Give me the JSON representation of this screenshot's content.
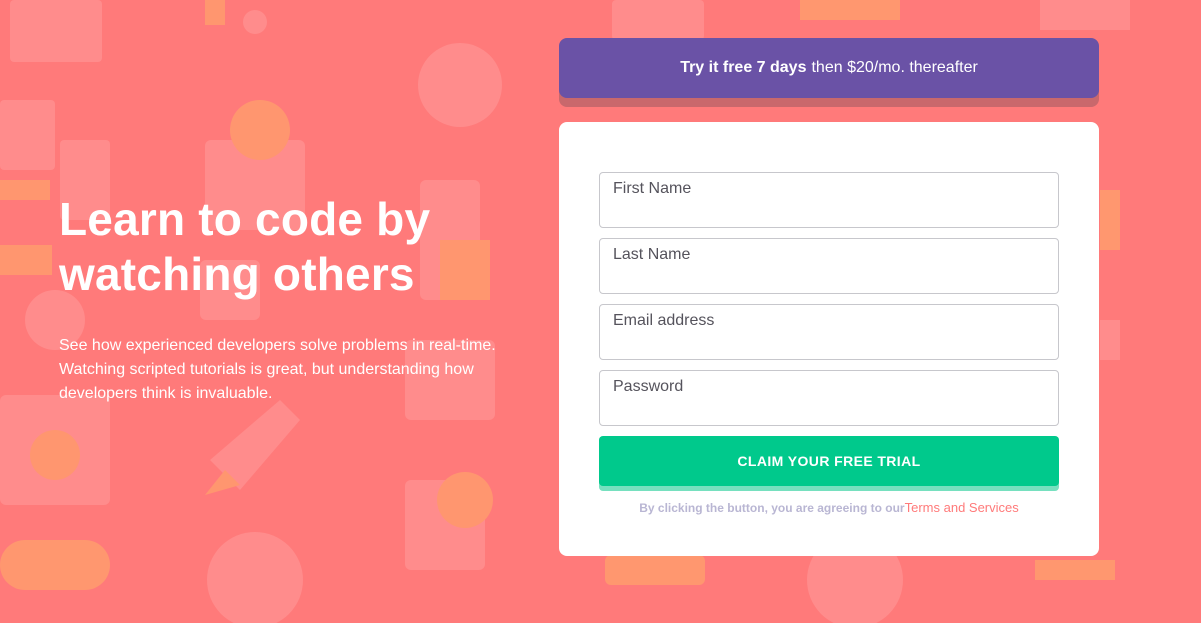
{
  "hero": {
    "title": "Learn to code by watching others",
    "description": "See how experienced developers solve problems in real-time. Watching scripted tutorials is great, but understanding how developers think is invaluable."
  },
  "promo": {
    "highlight": "Try it free 7 days",
    "rest": "then $20/mo. thereafter"
  },
  "form": {
    "first_name_placeholder": "First Name",
    "last_name_placeholder": "Last Name",
    "email_placeholder": "Email address",
    "password_placeholder": "Password",
    "submit_label": "CLAIM YOUR FREE TRIAL",
    "terms_text": "By clicking the button, you are agreeing to our",
    "terms_link": "Terms and Services"
  },
  "colors": {
    "background": "#ff7a7a",
    "promo": "#6a52a6",
    "cta": "#00c98c"
  }
}
